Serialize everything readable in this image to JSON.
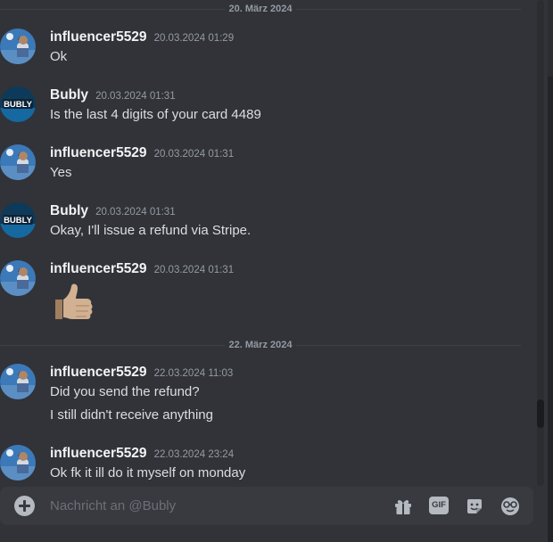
{
  "dividers": [
    "20. März 2024",
    "22. März 2024"
  ],
  "messages": [
    {
      "author": "influencer5529",
      "timestamp": "20.03.2024 01:29",
      "lines": [
        "Ok"
      ]
    },
    {
      "author": "Bubly",
      "timestamp": "20.03.2024 01:31",
      "lines": [
        "Is the last 4 digits of your card 4489"
      ]
    },
    {
      "author": "influencer5529",
      "timestamp": "20.03.2024 01:31",
      "lines": [
        "Yes"
      ]
    },
    {
      "author": "Bubly",
      "timestamp": "20.03.2024 01:31",
      "lines": [
        "Okay, I'll issue a refund via Stripe."
      ]
    },
    {
      "author": "influencer5529",
      "timestamp": "20.03.2024 01:31",
      "emoji": "thumbs-up"
    },
    {
      "author": "influencer5529",
      "timestamp": "22.03.2024 11:03",
      "lines": [
        "Did you send the refund?",
        "I still didn't receive anything"
      ]
    },
    {
      "author": "influencer5529",
      "timestamp": "22.03.2024 23:24",
      "lines": [
        "Ok fk it ill do it myself on monday"
      ]
    }
  ],
  "composer": {
    "placeholder": "Nachricht an @Bubly",
    "gif_label": "GIF"
  },
  "icons": [
    "add-circle-icon",
    "gift-icon",
    "gif-icon",
    "sticker-icon",
    "emoji-icon",
    "thumbs-up-emoji"
  ],
  "avatar_labels": {
    "bubly": "BUBLY"
  }
}
